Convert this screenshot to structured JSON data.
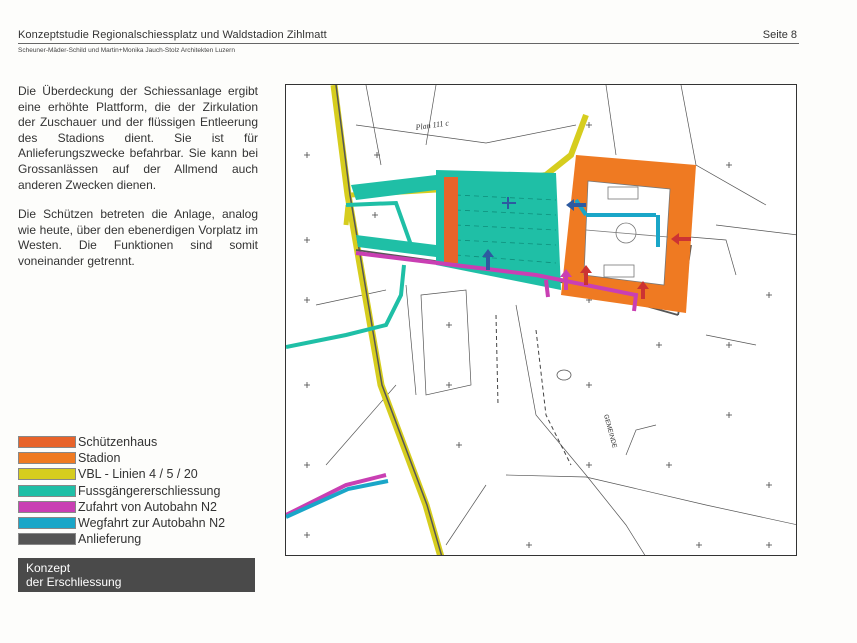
{
  "header": {
    "title": "Konzeptstudie Regionalschiessplatz und Waldstadion Zihlmatt",
    "page": "Seite 8",
    "authors": "Scheuner-Mäder-Schild und Martin+Monika Jauch-Stolz Architekten Luzern"
  },
  "body": {
    "paragraph1": "Die Überdeckung der Schiessanlage ergibt eine erhöhte Plattform, die der Zirkulation der Zuschauer und der flüssigen Entleerung des Stadions dient. Sie ist für Anlieferungszwecke befahrbar. Sie kann bei Grossanlässen auf der Allmend auch anderen Zwecken dienen.",
    "paragraph2": "Die Schützen betreten die Anlage, analog wie heute, über den ebenerdigen Vorplatz im Westen. Die Funktionen sind somit voneinander getrennt."
  },
  "legend": [
    {
      "label": "Schützenhaus",
      "color": "#e8632a"
    },
    {
      "label": "Stadion",
      "color": "#ef7a22"
    },
    {
      "label": "VBL - Linien 4 / 5 / 20",
      "color": "#d6cd1e"
    },
    {
      "label": "Fussgängererschliessung",
      "color": "#1fbfa6"
    },
    {
      "label": "Zufahrt von Autobahn N2",
      "color": "#c93fb3"
    },
    {
      "label": "Wegfahrt zur Autobahn N2",
      "color": "#1aa6c8"
    },
    {
      "label": "Anlieferung",
      "color": "#555555"
    }
  ],
  "caption": {
    "line1": "Konzept",
    "line2": "der Erschliessung"
  },
  "map": {
    "label_plan": "Plan 111 c",
    "label_gemeinde": "GEMEINDE"
  }
}
